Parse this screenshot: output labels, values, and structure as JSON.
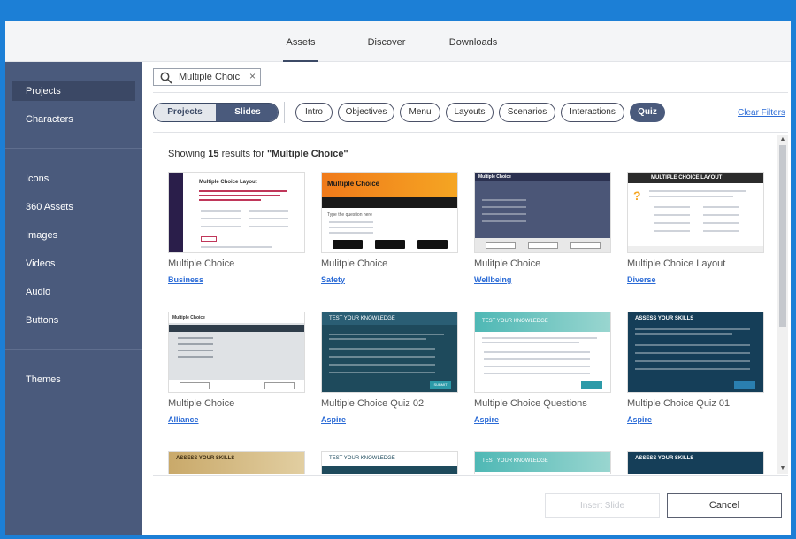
{
  "top_tabs": [
    {
      "label": "Assets",
      "active": true
    },
    {
      "label": "Discover",
      "active": false
    },
    {
      "label": "Downloads",
      "active": false
    }
  ],
  "sidebar": {
    "items": [
      {
        "label": "Projects",
        "active": true
      },
      {
        "label": "Characters"
      },
      {
        "label": "Icons"
      },
      {
        "label": "360 Assets"
      },
      {
        "label": "Images"
      },
      {
        "label": "Videos"
      },
      {
        "label": "Audio"
      },
      {
        "label": "Buttons"
      },
      {
        "label": "Themes"
      }
    ]
  },
  "search": {
    "value": "Multiple Choic",
    "clear_glyph": "×"
  },
  "segment": {
    "left": "Projects",
    "right": "Slides",
    "selected": "Slides"
  },
  "filters": [
    "Intro",
    "Objectives",
    "Menu",
    "Layouts",
    "Scenarios",
    "Interactions",
    "Quiz"
  ],
  "selected_filter": "Quiz",
  "clear_filters": "Clear Filters",
  "results": {
    "prefix": "Showing",
    "count": "15",
    "middle": "results for",
    "query": "\"Multiple Choice\""
  },
  "cards": [
    {
      "title": "Multiple Choice",
      "category": "Business"
    },
    {
      "title": "Mulitple Choice",
      "category": "Safety"
    },
    {
      "title": "Mulitple Choice",
      "category": "Wellbeing"
    },
    {
      "title": "Multiple Choice Layout",
      "category": "Diverse"
    },
    {
      "title": "Multiple Choice",
      "category": "Alliance"
    },
    {
      "title": "Multiple Choice Quiz 02",
      "category": "Aspire"
    },
    {
      "title": "Multiple Choice Questions",
      "category": "Aspire"
    },
    {
      "title": "Multiple Choice Quiz 01",
      "category": "Aspire"
    }
  ],
  "partial_cards": [
    {
      "heading": "ASSESS YOUR SKILLS"
    },
    {
      "heading": "TEST YOUR KNOWLEDGE"
    },
    {
      "heading": "TEST YOUR KNOWLEDGE"
    },
    {
      "heading": "ASSESS YOUR SKILLS"
    }
  ],
  "thumb_text": {
    "t1_title": "Multiple Choice Layout",
    "t2_title": "Multiple Choice",
    "t2_question": "Type the question here",
    "t3_title": "Multiple Choice",
    "t4_title": "MULTIPLE CHOICE LAYOUT",
    "t5_title": "Multiple Choice",
    "t6_title": "TEST YOUR KNOWLEDGE",
    "t7_title": "TEST YOUR KNOWLEDGE",
    "t8_title": "ASSESS YOUR SKILLS",
    "submit": "SUBMIT"
  },
  "buttons": {
    "insert": "Insert Slide",
    "cancel": "Cancel"
  },
  "colors": {
    "accent_blue": "#1c7fd6",
    "sidebar": "#4a5a7c",
    "link": "#2b6bd6"
  }
}
